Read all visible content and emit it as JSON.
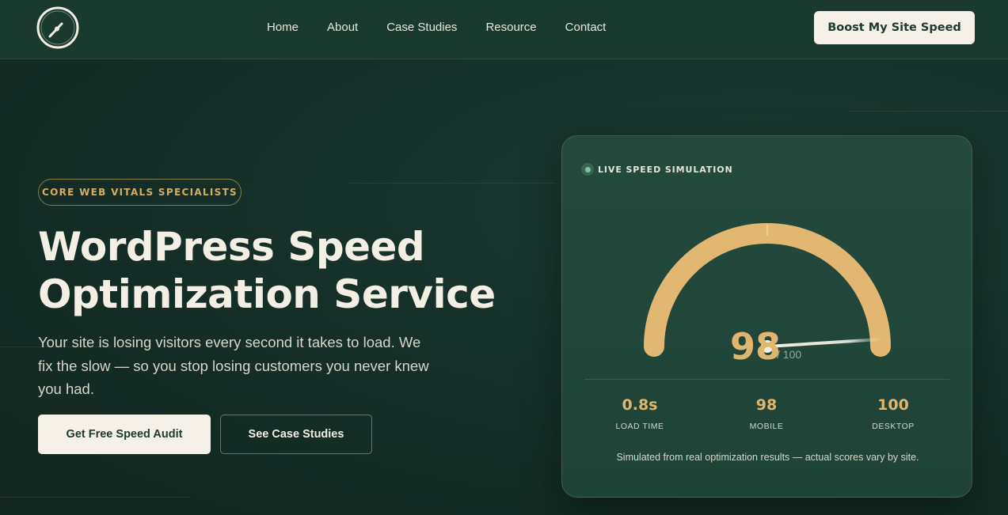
{
  "nav": {
    "items": [
      "Home",
      "About",
      "Case Studies",
      "Resource",
      "Contact"
    ],
    "cta": "Boost My Site Speed"
  },
  "hero": {
    "badge": "CORE WEB VITALS SPECIALISTS",
    "title_line1": "WordPress Speed",
    "title_line2": "Optimization Service",
    "subtitle": "Your site is losing visitors every second it takes to load. We fix the slow — so you stop losing customers you never knew you had.",
    "primary_button": "Get Free Speed Audit",
    "secondary_button": "See Case Studies"
  },
  "card": {
    "live_label": "LIVE SPEED SIMULATION",
    "score": "98",
    "score_max": "/ 100",
    "score_value": 98,
    "stats": [
      {
        "value": "0.8s",
        "label": "LOAD TIME"
      },
      {
        "value": "98",
        "label": "MOBILE"
      },
      {
        "value": "100",
        "label": "DESKTOP"
      }
    ],
    "note": "Simulated from real optimization results — actual scores vary by site."
  },
  "colors": {
    "accent_gold": "#e0b56e",
    "background": "#152a23",
    "header": "#1a3a30",
    "button_light": "#f5f1e8"
  }
}
